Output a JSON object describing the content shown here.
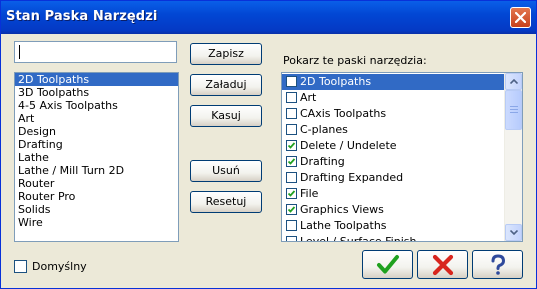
{
  "window": {
    "title": "Stan Paska Narzędzi"
  },
  "search": {
    "value": ""
  },
  "left_list": {
    "items": [
      "2D Toolpaths",
      "3D Toolpaths",
      "4-5 Axis Toolpaths",
      "Art",
      "Design",
      "Drafting",
      "Lathe",
      "Lathe / Mill Turn 2D",
      "Router",
      "Router Pro",
      "Solids",
      "Wire"
    ],
    "selected_index": 0
  },
  "buttons": {
    "save": "Zapisz",
    "load": "Załaduj",
    "delete": "Kasuj",
    "remove": "Usuń",
    "reset": "Resetuj"
  },
  "toolbars": {
    "label": "Pokarz te paski narzędzia:",
    "items": [
      {
        "label": "2D Toolpaths",
        "checked": false,
        "selected": true
      },
      {
        "label": "Art",
        "checked": false
      },
      {
        "label": "CAxis Toolpaths",
        "checked": false
      },
      {
        "label": "C-planes",
        "checked": false
      },
      {
        "label": "Delete / Undelete",
        "checked": true
      },
      {
        "label": "Drafting",
        "checked": true
      },
      {
        "label": "Drafting Expanded",
        "checked": false
      },
      {
        "label": "File",
        "checked": true
      },
      {
        "label": "Graphics Views",
        "checked": true
      },
      {
        "label": "Lathe Toolpaths",
        "checked": false
      },
      {
        "label": "Level / Surface Finish",
        "checked": false
      }
    ]
  },
  "default": {
    "label": "Domyślny",
    "checked": false
  },
  "dialog_buttons": {
    "ok_icon": "check-icon",
    "cancel_icon": "x-icon",
    "help_icon": "question-icon"
  },
  "colors": {
    "title_bar": "#0247d4",
    "selection": "#316ac5",
    "ok_green": "#1fa11f",
    "cancel_red": "#d8261e",
    "help_blue": "#2f4a9c"
  }
}
